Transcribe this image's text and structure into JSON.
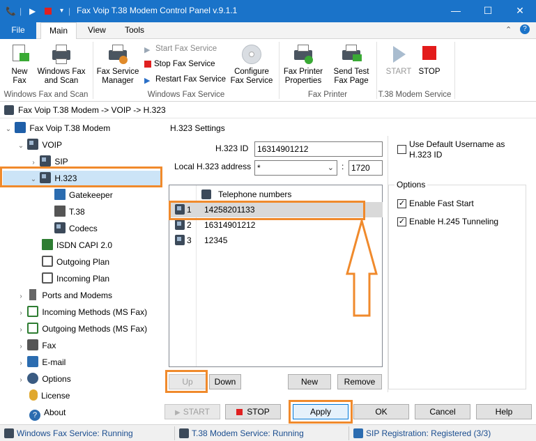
{
  "window": {
    "title": "Fax Voip T.38 Modem Control Panel v.9.1.1",
    "minimize": "—",
    "maximize": "☐",
    "close": "✕"
  },
  "tabs": {
    "file": "File",
    "main": "Main",
    "view": "View",
    "tools": "Tools"
  },
  "ribbon": {
    "new_fax": "New Fax",
    "windows_fax_scan": "Windows Fax and Scan",
    "group_windows_fax_scan": "Windows Fax and Scan",
    "fax_service_manager": "Fax Service Manager",
    "start_fax_service": "Start Fax Service",
    "stop_fax_service": "Stop Fax Service",
    "restart_fax_service": "Restart Fax Service",
    "configure_fax_service": "Configure Fax Service",
    "group_windows_fax_service": "Windows Fax Service",
    "fax_printer_properties": "Fax Printer Properties",
    "send_test_fax_page": "Send Test Fax Page",
    "group_fax_printer": "Fax Printer",
    "start": "START",
    "stop": "STOP",
    "group_t38": "T.38 Modem Service"
  },
  "breadcrumb": "Fax Voip T.38 Modem -> VOIP -> H.323",
  "tree": {
    "root": "Fax Voip T.38 Modem",
    "voip": "VOIP",
    "sip": "SIP",
    "h323": "H.323",
    "gatekeeper": "Gatekeeper",
    "t38": "T.38",
    "codecs": "Codecs",
    "isdn": "ISDN CAPI 2.0",
    "outgoing_plan": "Outgoing Plan",
    "incoming_plan": "Incoming Plan",
    "ports_modems": "Ports and Modems",
    "incoming_methods": "Incoming Methods (MS Fax)",
    "outgoing_methods": "Outgoing Methods (MS Fax)",
    "fax": "Fax",
    "email": "E-mail",
    "options": "Options",
    "license": "License",
    "about": "About"
  },
  "settings": {
    "group_title": "H.323 Settings",
    "h323_id_label": "H.323 ID",
    "h323_id_value": "16314901212",
    "local_addr_label": "Local H.323 address",
    "local_addr_value": "*",
    "port_sep": ":",
    "port_value": "1720",
    "list_header": "Telephone numbers",
    "numbers": [
      {
        "index": "1",
        "value": "14258201133"
      },
      {
        "index": "2",
        "value": "16314901212"
      },
      {
        "index": "3",
        "value": "12345"
      }
    ],
    "up": "Up",
    "down": "Down",
    "new": "New",
    "remove": "Remove",
    "use_default_username": "Use Default Username as H.323 ID",
    "options_title": "Options",
    "enable_fast_start": "Enable Fast Start",
    "enable_h245": "Enable H.245 Tunneling"
  },
  "bottom": {
    "start": "START",
    "stop": "STOP",
    "apply": "Apply",
    "ok": "OK",
    "cancel": "Cancel",
    "help": "Help"
  },
  "status": {
    "windows_fax": "Windows Fax Service: Running",
    "t38_modem": "T.38 Modem Service: Running",
    "sip_registration": "SIP Registration: Registered (3/3)"
  },
  "colors": {
    "accent": "#1a73c9",
    "highlight": "#f08a2c",
    "selection": "#cce4f7"
  }
}
